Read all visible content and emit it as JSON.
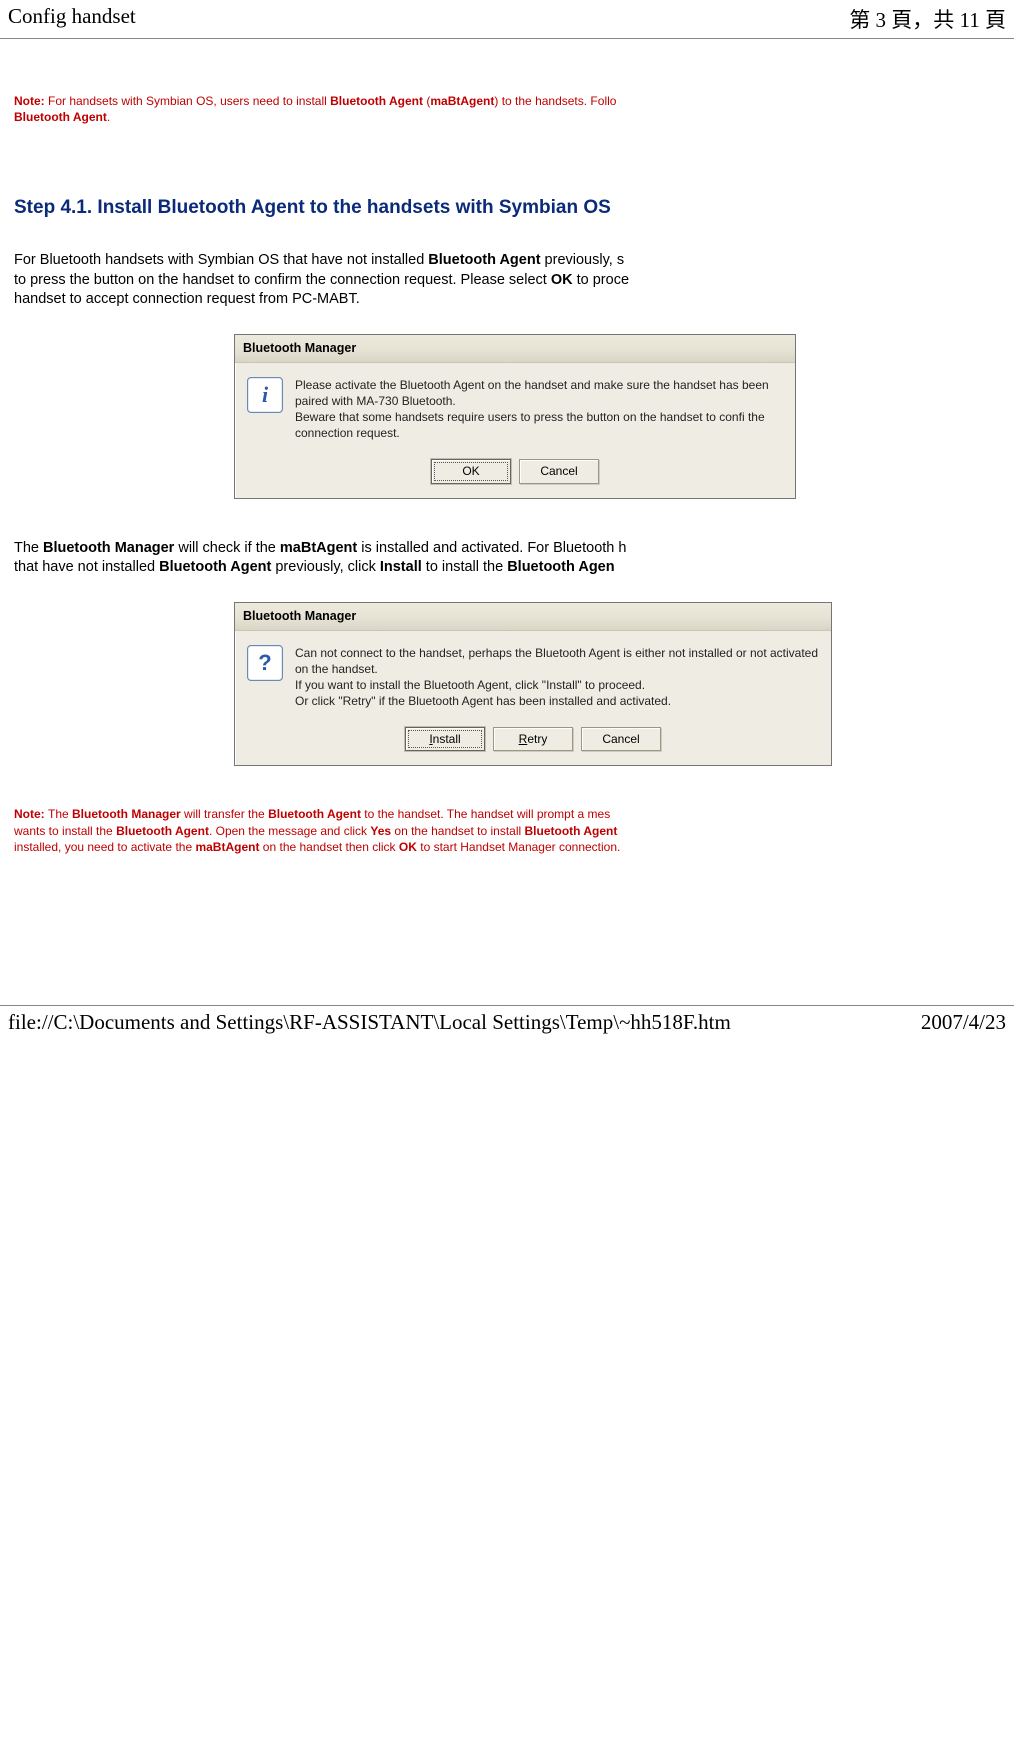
{
  "header": {
    "title": "Config handset",
    "page_info": "第 3 頁，共 11 頁"
  },
  "note1": {
    "label": "Note: ",
    "text_a": "For handsets with Symbian OS, users need to install ",
    "b1": "Bluetooth Agent",
    "text_b": " (",
    "b2": "maBtAgent",
    "text_c": ") to the handsets. Follo",
    "b3": "Bluetooth Agent",
    "text_d": "."
  },
  "section_title": "Step 4.1. Install Bluetooth Agent to the handsets with Symbian OS",
  "para1": {
    "a": "For Bluetooth handsets with Symbian OS that have not installed ",
    "b1": "Bluetooth Agent",
    "b": " previously, s",
    "c": "to press the button on the handset to confirm the connection request. Please select ",
    "b2": "OK",
    "d": " to proce",
    "e": "handset to accept connection request from PC-MABT."
  },
  "dialog1": {
    "title": "Bluetooth Manager",
    "icon": "info-icon",
    "text": "Please activate the Bluetooth Agent on the handset and make sure the handset has been paired with MA-730 Bluetooth.\nBeware that some handsets require users to press the button on the handset to confi the connection request.",
    "buttons": {
      "ok": "OK",
      "cancel": "Cancel"
    }
  },
  "para2": {
    "a": "The ",
    "b1": "Bluetooth Manager",
    "b": " will check if the ",
    "b2": "maBtAgent",
    "c": " is installed and activated. For Bluetooth h",
    "d": "that have not installed ",
    "b3": "Bluetooth Agent",
    "e": " previously, click ",
    "b4": "Install",
    "f": " to install the ",
    "b5": "Bluetooth Agen"
  },
  "dialog2": {
    "title": "Bluetooth Manager",
    "icon": "question-icon",
    "text": "Can not connect to the handset, perhaps the Bluetooth Agent is either not installed or not activated on the handset.\nIf you want to install the Bluetooth Agent, click \"Install\" to proceed.\nOr click \"Retry\" if the Bluetooth Agent has been installed and activated.",
    "buttons": {
      "install": "Install",
      "retry": "Retry",
      "cancel": "Cancel"
    }
  },
  "note2": {
    "label": "Note: ",
    "a": "The ",
    "b1": "Bluetooth Manager",
    "b": " will transfer the ",
    "b2": "Bluetooth Agent",
    "c": " to the handset. The handset will prompt a mes",
    "d": "wants to install the ",
    "b3": "Bluetooth Agent",
    "e": ". Open the message and click ",
    "b4": "Yes",
    "f": " on the handset to install ",
    "b5": "Bluetooth Agent",
    "g": "installed, you need to activate the ",
    "b6": "maBtAgent",
    "h": " on the handset then click ",
    "b7": "OK",
    "i": " to start Handset Manager connection."
  },
  "footer": {
    "path": "file://C:\\Documents and Settings\\RF-ASSISTANT\\Local Settings\\Temp\\~hh518F.htm",
    "date": "2007/4/23"
  }
}
